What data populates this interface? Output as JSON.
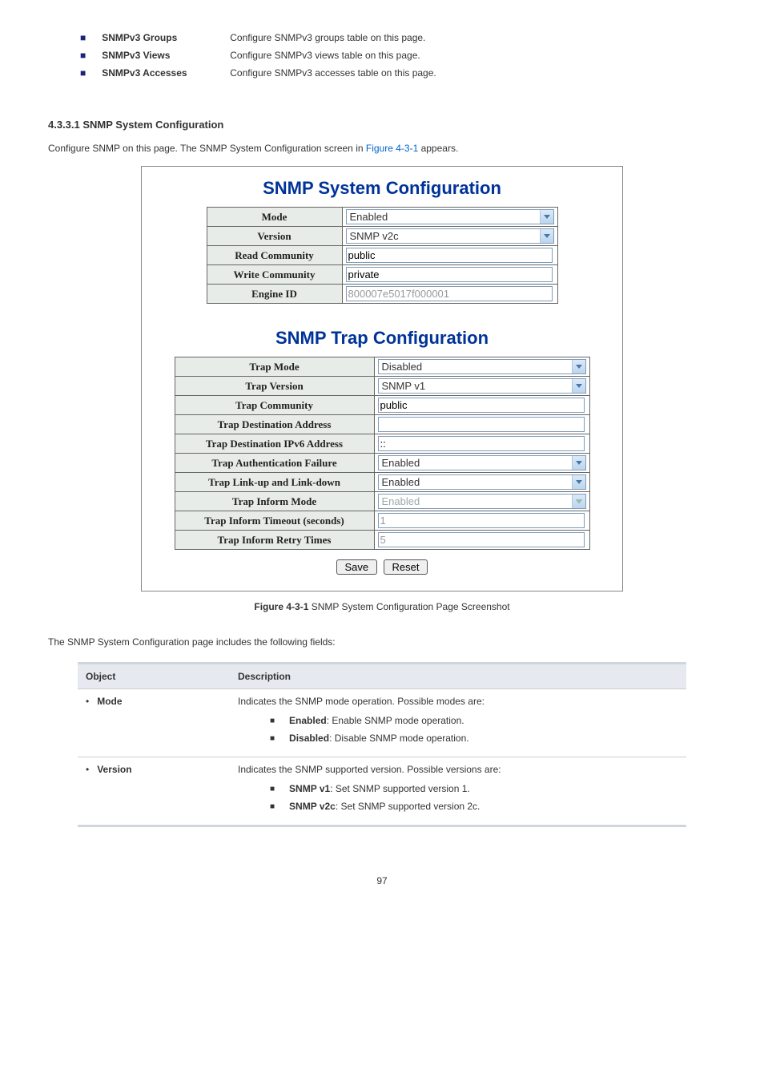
{
  "top_bullets": [
    {
      "label": "SNMPv3 Groups",
      "desc": "Configure SNMPv3 groups table on this page."
    },
    {
      "label": "SNMPv3 Views",
      "desc": "Configure SNMPv3 views table on this page."
    },
    {
      "label": "SNMPv3 Accesses",
      "desc": "Configure SNMPv3 accesses table on this page."
    }
  ],
  "section_heading": "4.3.3.1 SNMP System Configuration",
  "intro": {
    "text_a": "Configure SNMP on this page. The SNMP System Configuration screen in ",
    "link": "Figure 4-3-1",
    "text_b": " appears."
  },
  "panel1": {
    "title": "SNMP System Configuration",
    "rows": {
      "mode": {
        "label": "Mode",
        "value": "Enabled",
        "type": "select"
      },
      "version": {
        "label": "Version",
        "value": "SNMP v2c",
        "type": "select"
      },
      "read": {
        "label": "Read Community",
        "value": "public",
        "type": "text"
      },
      "write": {
        "label": "Write Community",
        "value": "private",
        "type": "text"
      },
      "engine": {
        "label": "Engine ID",
        "value": "800007e5017f000001",
        "type": "text_disabled"
      }
    }
  },
  "panel2": {
    "title": "SNMP Trap Configuration",
    "rows": {
      "tmode": {
        "label": "Trap Mode",
        "value": "Disabled",
        "type": "select"
      },
      "tver": {
        "label": "Trap Version",
        "value": "SNMP v1",
        "type": "select"
      },
      "tcomm": {
        "label": "Trap Community",
        "value": "public",
        "type": "text"
      },
      "tdest": {
        "label": "Trap Destination Address",
        "value": "",
        "type": "text"
      },
      "tdest6": {
        "label": "Trap Destination IPv6 Address",
        "value": "::",
        "type": "text"
      },
      "tauth": {
        "label": "Trap Authentication Failure",
        "value": "Enabled",
        "type": "select"
      },
      "tlink": {
        "label": "Trap Link-up and Link-down",
        "value": "Enabled",
        "type": "select"
      },
      "tinf": {
        "label": "Trap Inform Mode",
        "value": "Enabled",
        "type": "select_disabled"
      },
      "ttimeout": {
        "label": "Trap Inform Timeout (seconds)",
        "value": "1",
        "type": "text_disabled"
      },
      "tretry": {
        "label": "Trap Inform Retry Times",
        "value": "5",
        "type": "text_disabled"
      }
    },
    "save": "Save",
    "reset": "Reset"
  },
  "figure_caption": {
    "prefix": "Figure 4-3-1",
    "text": " SNMP System Configuration Page Screenshot"
  },
  "desc_text": "The SNMP System Configuration page includes the following fields:",
  "fields": {
    "header_obj": "Object",
    "header_desc": "Description",
    "rows": [
      {
        "obj": "Mode",
        "desc": "Indicates the SNMP mode operation. Possible modes are:",
        "subs": [
          {
            "label": "Enabled",
            "text": ": Enable SNMP mode operation."
          },
          {
            "label": "Disabled",
            "text": ": Disable SNMP mode operation."
          }
        ]
      },
      {
        "obj": "Version",
        "desc": "Indicates the SNMP supported version. Possible versions are:",
        "subs": [
          {
            "label": "SNMP v1",
            "text": ": Set SNMP supported version 1."
          },
          {
            "label": "SNMP v2c",
            "text": ": Set SNMP supported version 2c."
          }
        ]
      }
    ]
  },
  "page_number": "97"
}
